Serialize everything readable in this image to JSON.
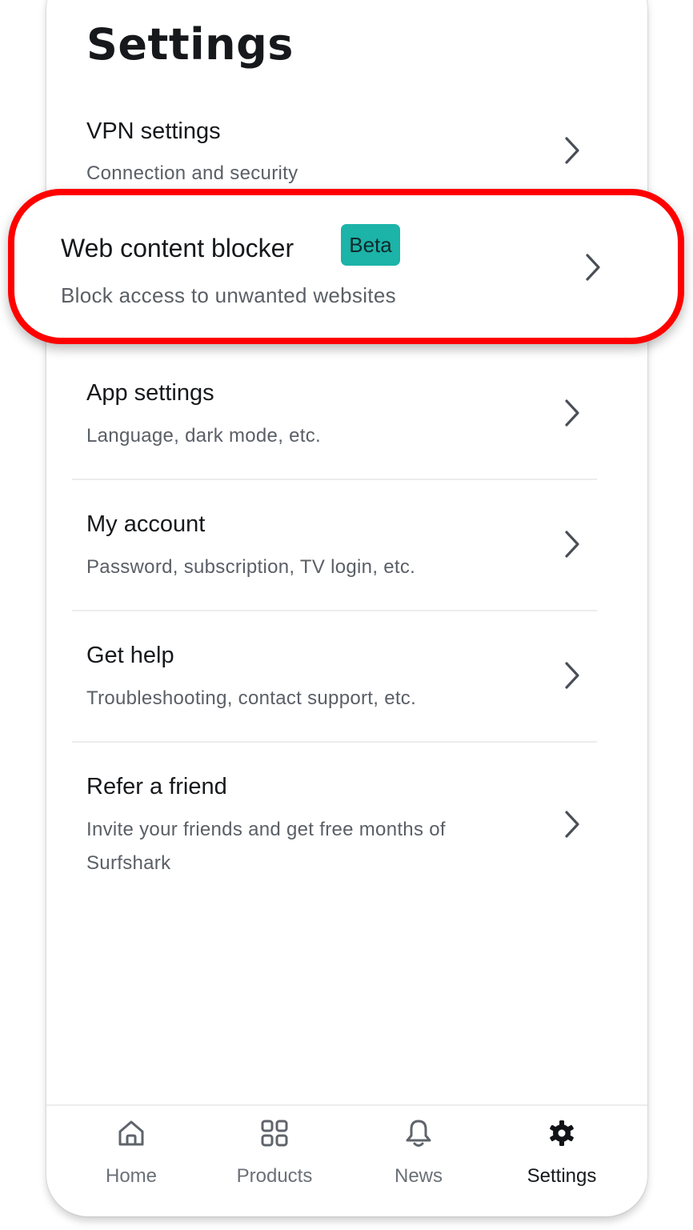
{
  "page": {
    "title": "Settings"
  },
  "highlight_color": "#ff0000",
  "badge_color": "#1cb3a9",
  "settings": [
    {
      "title": "VPN settings",
      "subtitle": "Connection and security",
      "icon": "chevron-right-icon"
    },
    {
      "title": "Web content blocker",
      "badge": "Beta",
      "subtitle": "Block access to unwanted websites",
      "icon": "chevron-right-icon",
      "highlighted": true
    },
    {
      "title": "App settings",
      "subtitle": "Language, dark mode, etc.",
      "icon": "chevron-right-icon"
    },
    {
      "title": "My account",
      "subtitle": "Password, subscription, TV login, etc.",
      "icon": "chevron-right-icon"
    },
    {
      "title": "Get help",
      "subtitle": "Troubleshooting, contact support, etc.",
      "icon": "chevron-right-icon"
    },
    {
      "title": "Refer a friend",
      "subtitle": "Invite your friends and get free months of Surfshark",
      "icon": "chevron-right-icon"
    }
  ],
  "nav": [
    {
      "label": "Home",
      "icon": "home-icon"
    },
    {
      "label": "Products",
      "icon": "grid-icon"
    },
    {
      "label": "News",
      "icon": "bell-icon"
    },
    {
      "label": "Settings",
      "icon": "gear-icon",
      "active": true
    }
  ]
}
